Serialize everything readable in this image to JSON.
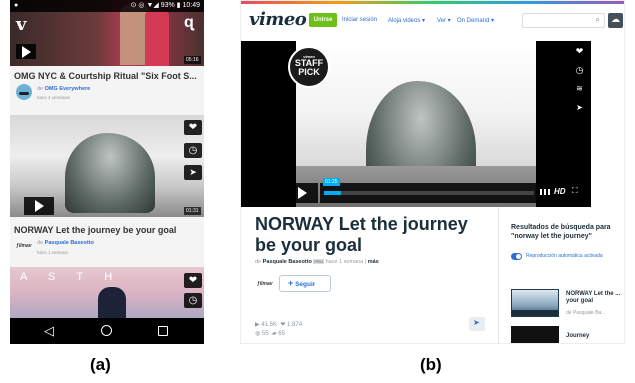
{
  "phone": {
    "status": {
      "left_icon": "circle-icon",
      "right_text": "93% ▮ 10:49",
      "signal_icons": "⊙ ◎ ▼◢"
    },
    "top_video": {
      "duration": "05:16"
    },
    "video1": {
      "title": "OMG NYC & Courtship Ritual \"Six Foot S...",
      "by_prefix": "de",
      "author": "OMG Everywhere",
      "ago": "hace 4 semanas"
    },
    "video2": {
      "duration": "01:31",
      "title": "NORWAY Let the journey be your goal",
      "by_prefix": "de",
      "author": "Pasquale Baseotto",
      "ago": "hace 1 semana",
      "logo_text": "ƒilmav"
    },
    "video3": {
      "overlay_text": "A     S     T     H"
    }
  },
  "desktop": {
    "header": {
      "logo": "vimeo",
      "join": "Unirse",
      "links": [
        "Iniciar sesión",
        "Aloja videos ▾",
        "Ver ▾",
        "On Demand ▾"
      ]
    },
    "player": {
      "staff_pick_small": "vimeo",
      "staff_pick_line1": "STAFF",
      "staff_pick_line2": "PICK",
      "time": "01:25",
      "hd": "HD",
      "progress": 0.08
    },
    "video": {
      "title": "NORWAY Let the journey be your goal",
      "by_prefix": "de",
      "author": "Pasquale Baseotto",
      "badge": "PRO",
      "ago": "hace 1 semana",
      "more": "más",
      "channel_logo": "ƒilmav",
      "follow": "Seguir",
      "plays": "41,5K",
      "likes": "1.874",
      "collections": "55",
      "comments": "65"
    },
    "sidebar": {
      "results_title": "Resultados de búsqueda para \"norway let the journey\"",
      "autoplay": "Reproducción automática activada",
      "result1_title": "NORWAY Let the ... your goal",
      "result1_by": "de Pasquale Ba...",
      "result2_title": "Journey"
    }
  },
  "captions": {
    "a": "(a)",
    "b": "(b)"
  },
  "colors": {
    "accent_blue": "#2b6fd6",
    "vimeo_cyan": "#00adef",
    "join_green": "#6fbf1a",
    "dark_navy": "#1a2e3b"
  }
}
